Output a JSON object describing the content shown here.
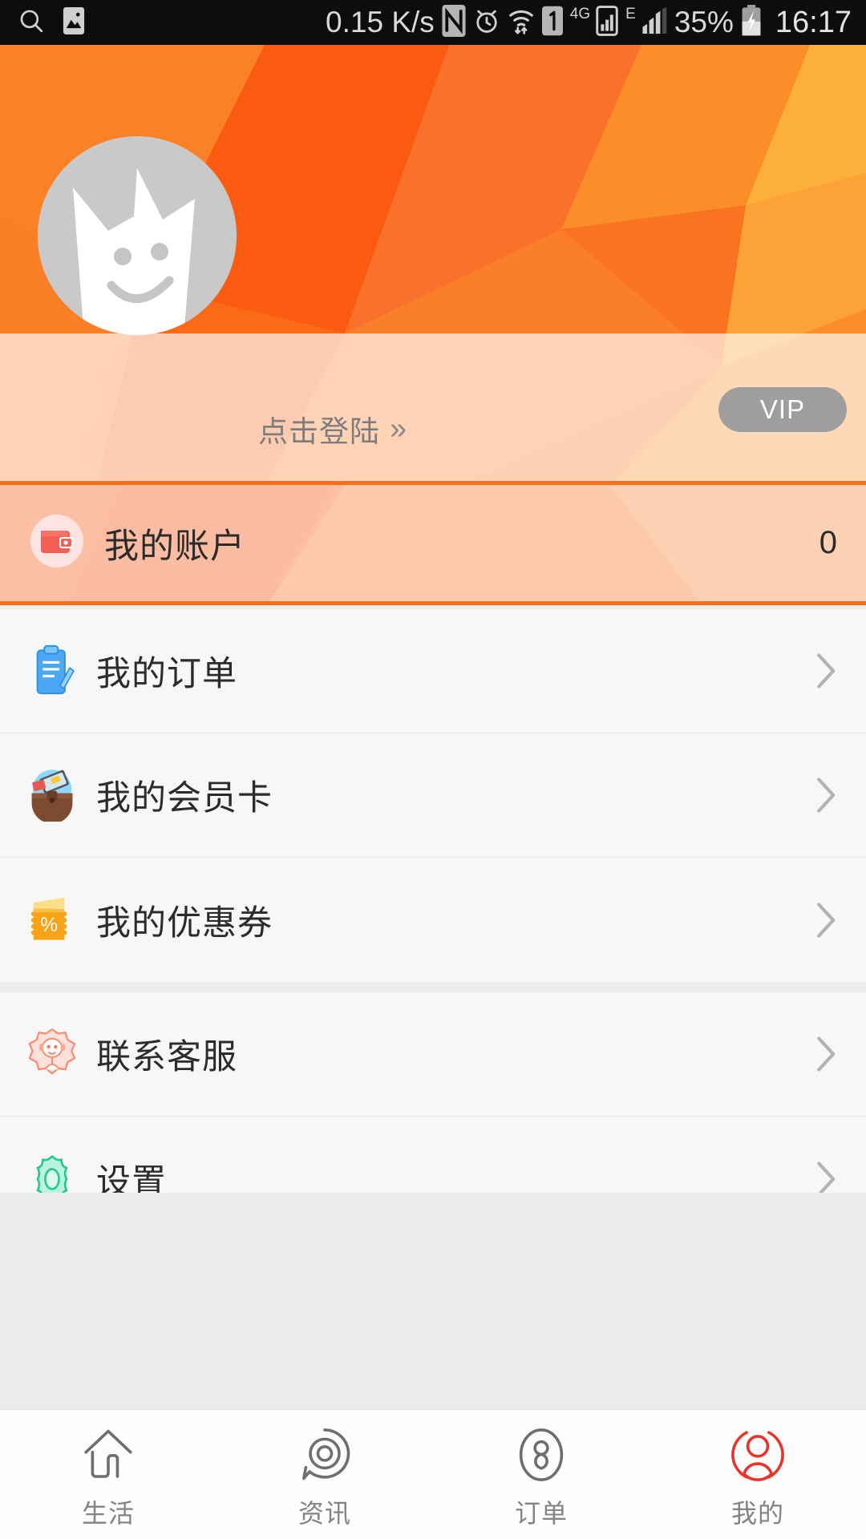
{
  "statusbar": {
    "icons_left": [
      "search-icon",
      "screenshot-icon"
    ],
    "network_speed": "0.15 K/s",
    "icons_mid": [
      "nfc-icon",
      "alarm-icon",
      "wifi-icon",
      "sim1-icon",
      "signal-4g-icon",
      "signal-e-icon"
    ],
    "label_4g": "4G",
    "label_e": "E",
    "battery": "35%",
    "battery_icon": "battery-charging-icon",
    "time": "16:17"
  },
  "header": {
    "avatar_name": "cat-avatar",
    "login_label": "点击登陆",
    "login_chevron": "»",
    "vip_label": "VIP",
    "colors": {
      "orange_dark": "#fb5b10",
      "orange_mid": "#fb7a22",
      "orange_light": "#fca233",
      "veil": "#fcd5bd"
    }
  },
  "account": {
    "icon": "wallet-icon",
    "label": "我的账户",
    "value": "0",
    "border_color": "#f8701b"
  },
  "menu": {
    "groups": [
      {
        "items": [
          {
            "icon": "clipboard-order-icon",
            "label": "我的订单",
            "chevron": "chevron-right-icon"
          },
          {
            "icon": "membership-card-icon",
            "label": "我的会员卡",
            "chevron": "chevron-right-icon"
          },
          {
            "icon": "coupon-percent-icon",
            "label": "我的优惠券",
            "chevron": "chevron-right-icon"
          }
        ]
      },
      {
        "items": [
          {
            "icon": "headset-support-icon",
            "label": "联系客服",
            "chevron": "chevron-right-icon"
          },
          {
            "icon": "gear-settings-icon",
            "label": "设置",
            "chevron": "chevron-right-icon"
          }
        ]
      }
    ]
  },
  "tabbar": {
    "active_color": "#e8352c",
    "inactive_color": "#6e6e6e",
    "items": [
      {
        "icon": "home-life-icon",
        "label": "生活",
        "active": false
      },
      {
        "icon": "news-bubble-icon",
        "label": "资讯",
        "active": false
      },
      {
        "icon": "order-hourglass-icon",
        "label": "订单",
        "active": false
      },
      {
        "icon": "profile-person-icon",
        "label": "我的",
        "active": true
      }
    ]
  }
}
